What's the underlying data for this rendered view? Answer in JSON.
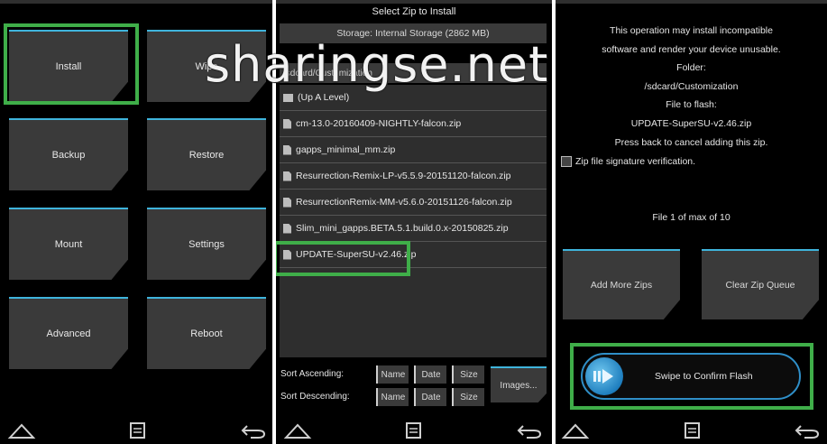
{
  "panel1": {
    "buttons": [
      "Install",
      "Wipe",
      "Backup",
      "Restore",
      "Mount",
      "Settings",
      "Advanced",
      "Reboot"
    ]
  },
  "panel2": {
    "title": "Select Zip to Install",
    "storage": "Storage: Internal Storage (2862 MB)",
    "path": "/sdcard/Customization",
    "files": [
      "(Up A Level)",
      "cm-13.0-20160409-NIGHTLY-falcon.zip",
      "gapps_minimal_mm.zip",
      "Resurrection-Remix-LP-v5.5.9-20151120-falcon.zip",
      "ResurrectionRemix-MM-v5.6.0-20151126-falcon.zip",
      "Slim_mini_gapps.BETA.5.1.build.0.x-20150825.zip",
      "UPDATE-SuperSU-v2.46.zip"
    ],
    "sort_ascending": "Sort Ascending:",
    "sort_descending": "Sort Descending:",
    "sort_name": "Name",
    "sort_date": "Date",
    "sort_size": "Size",
    "images": "Images..."
  },
  "panel3": {
    "warning1": "This operation may install incompatible",
    "warning2": "software and render your device unusable.",
    "folder_label": "Folder:",
    "folder": "/sdcard/Customization",
    "file_label": "File to flash:",
    "file": "UPDATE-SuperSU-v2.46.zip",
    "back_hint": "Press back to cancel adding this zip.",
    "signature": "Zip file signature verification.",
    "count": "File 1 of max of 10",
    "add_more": "Add More Zips",
    "clear_queue": "Clear Zip Queue",
    "swipe": "Swipe to Confirm Flash"
  },
  "watermark": "sharingse.net",
  "colors": {
    "accent": "#3fb4dc",
    "highlight": "#3fae49",
    "tile": "#3a3a3a"
  }
}
